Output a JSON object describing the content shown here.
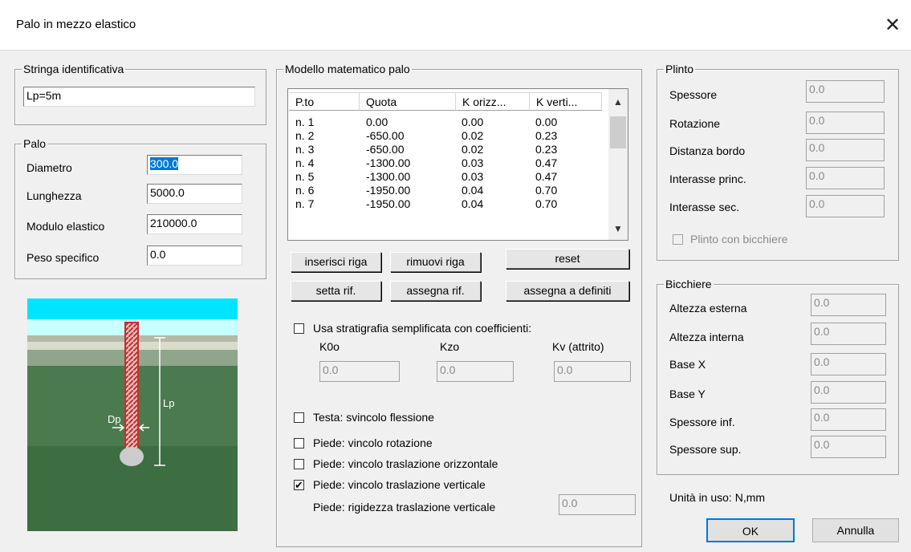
{
  "dialog": {
    "title": "Palo in mezzo elastico",
    "close_glyph": "✕"
  },
  "stringa": {
    "legend": "Stringa identificativa",
    "value": "Lp=5m"
  },
  "palo": {
    "legend": "Palo",
    "fields": [
      {
        "label": "Diametro",
        "value": "300.0"
      },
      {
        "label": "Lunghezza",
        "value": "5000.0"
      },
      {
        "label": "Modulo elastico",
        "value": "210000.0"
      },
      {
        "label": "Peso specifico",
        "value": "0.0"
      }
    ]
  },
  "diagram": {
    "lp_label": "Lp",
    "dp_label": "Dp"
  },
  "modello": {
    "legend": "Modello matematico palo",
    "columns": [
      "P.to",
      "Quota",
      "K orizz...",
      "K verti..."
    ],
    "rows": [
      [
        "n. 1",
        "0.00",
        "0.00",
        "0.00"
      ],
      [
        "n. 2",
        "-650.00",
        "0.02",
        "0.23"
      ],
      [
        "n. 3",
        "-650.00",
        "0.02",
        "0.23"
      ],
      [
        "n. 4",
        "-1300.00",
        "0.03",
        "0.47"
      ],
      [
        "n. 5",
        "-1300.00",
        "0.03",
        "0.47"
      ],
      [
        "n. 6",
        "-1950.00",
        "0.04",
        "0.70"
      ],
      [
        "n. 7",
        "-1950.00",
        "0.04",
        "0.70"
      ]
    ],
    "buttons": {
      "inserisci": "inserisci riga",
      "rimuovi": "rimuovi riga",
      "reset": "reset",
      "setta": "setta rif.",
      "assegna": "assegna rif.",
      "assegna_definiti": "assegna a definiti"
    },
    "stratigrafia": {
      "label": "Usa stratigrafia semplificata con coefficienti:",
      "checked": false,
      "fields": [
        {
          "label": "K0o",
          "value": "0.0"
        },
        {
          "label": "Kzo",
          "value": "0.0"
        },
        {
          "label": "Kv (attrito)",
          "value": "0.0"
        }
      ]
    },
    "options": [
      {
        "label": "Testa: svincolo flessione",
        "checked": false
      },
      {
        "label": "Piede: vincolo rotazione",
        "checked": false
      },
      {
        "label": "Piede: vincolo traslazione orizzontale",
        "checked": false
      },
      {
        "label": "Piede: vincolo traslazione verticale",
        "checked": true
      }
    ],
    "rigidezza": {
      "label": "Piede: rigidezza traslazione verticale",
      "value": "0.0"
    }
  },
  "plinto": {
    "legend": "Plinto",
    "fields": [
      {
        "label": "Spessore",
        "value": "0.0"
      },
      {
        "label": "Rotazione",
        "value": "0.0"
      },
      {
        "label": "Distanza bordo",
        "value": "0.0"
      },
      {
        "label": "Interasse princ.",
        "value": "0.0"
      },
      {
        "label": "Interasse sec.",
        "value": "0.0"
      }
    ],
    "bicchiere_check": {
      "label": "Plinto con bicchiere",
      "checked": false
    }
  },
  "bicchiere": {
    "legend": "Bicchiere",
    "fields": [
      {
        "label": "Altezza esterna",
        "value": "0.0"
      },
      {
        "label": "Altezza interna",
        "value": "0.0"
      },
      {
        "label": "Base X",
        "value": "0.0"
      },
      {
        "label": "Base Y",
        "value": "0.0"
      },
      {
        "label": "Spessore inf.",
        "value": "0.0"
      },
      {
        "label": "Spessore sup.",
        "value": "0.0"
      }
    ]
  },
  "footer": {
    "units": "Unità in uso:  N,mm",
    "ok": "OK",
    "annulla": "Annulla"
  }
}
